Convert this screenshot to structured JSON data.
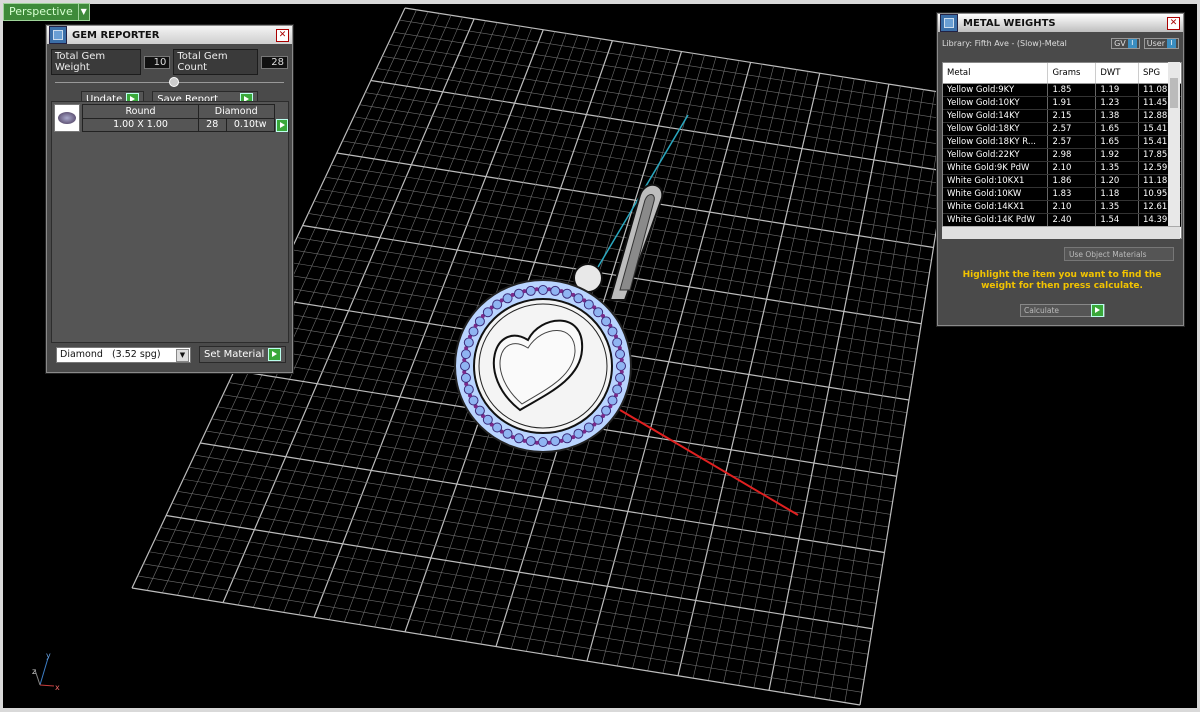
{
  "viewport": {
    "view_label": "Perspective"
  },
  "gem_reporter": {
    "title": "GEM REPORTER",
    "total_weight_label": "Total Gem Weight",
    "total_weight_value": "10",
    "total_count_label": "Total Gem Count",
    "total_count_value": "28",
    "update_label": "Update",
    "save_report_label": "Save Report",
    "gem": {
      "shape": "Round",
      "type": "Diamond",
      "size": "1.00 X 1.00",
      "count": "28",
      "weight": "0.10tw"
    },
    "material_select": "Diamond   (3.52 spg)",
    "set_material_label": "Set Material"
  },
  "metal_weights": {
    "title": "METAL WEIGHTS",
    "library": "Library: Fifth Ave - (Slow)-Metal",
    "toggle_gv": "GV",
    "toggle_user": "User",
    "columns": [
      "Metal",
      "Grams",
      "DWT",
      "SPG"
    ],
    "rows": [
      [
        "Yellow Gold:9KY",
        "1.85",
        "1.19",
        "11.08"
      ],
      [
        "Yellow Gold:10KY",
        "1.91",
        "1.23",
        "11.45"
      ],
      [
        "Yellow Gold:14KY",
        "2.15",
        "1.38",
        "12.88"
      ],
      [
        "Yellow Gold:18KY",
        "2.57",
        "1.65",
        "15.41"
      ],
      [
        "Yellow Gold:18KY R...",
        "2.57",
        "1.65",
        "15.41"
      ],
      [
        "Yellow Gold:22KY",
        "2.98",
        "1.92",
        "17.85"
      ],
      [
        "White Gold:9K PdW",
        "2.10",
        "1.35",
        "12.59"
      ],
      [
        "White Gold:10KX1",
        "1.86",
        "1.20",
        "11.18"
      ],
      [
        "White Gold:10KW",
        "1.83",
        "1.18",
        "10.95"
      ],
      [
        "White Gold:14KX1",
        "2.10",
        "1.35",
        "12.61"
      ],
      [
        "White Gold:14K PdW",
        "2.40",
        "1.54",
        "14.39"
      ]
    ],
    "use_object_materials": "Use Object Materials",
    "hint": "Highlight the item you want to find the weight for then press calculate.",
    "calculate": "Calculate"
  },
  "axis_labels": {
    "y": "y",
    "z": "z",
    "x": "x"
  }
}
